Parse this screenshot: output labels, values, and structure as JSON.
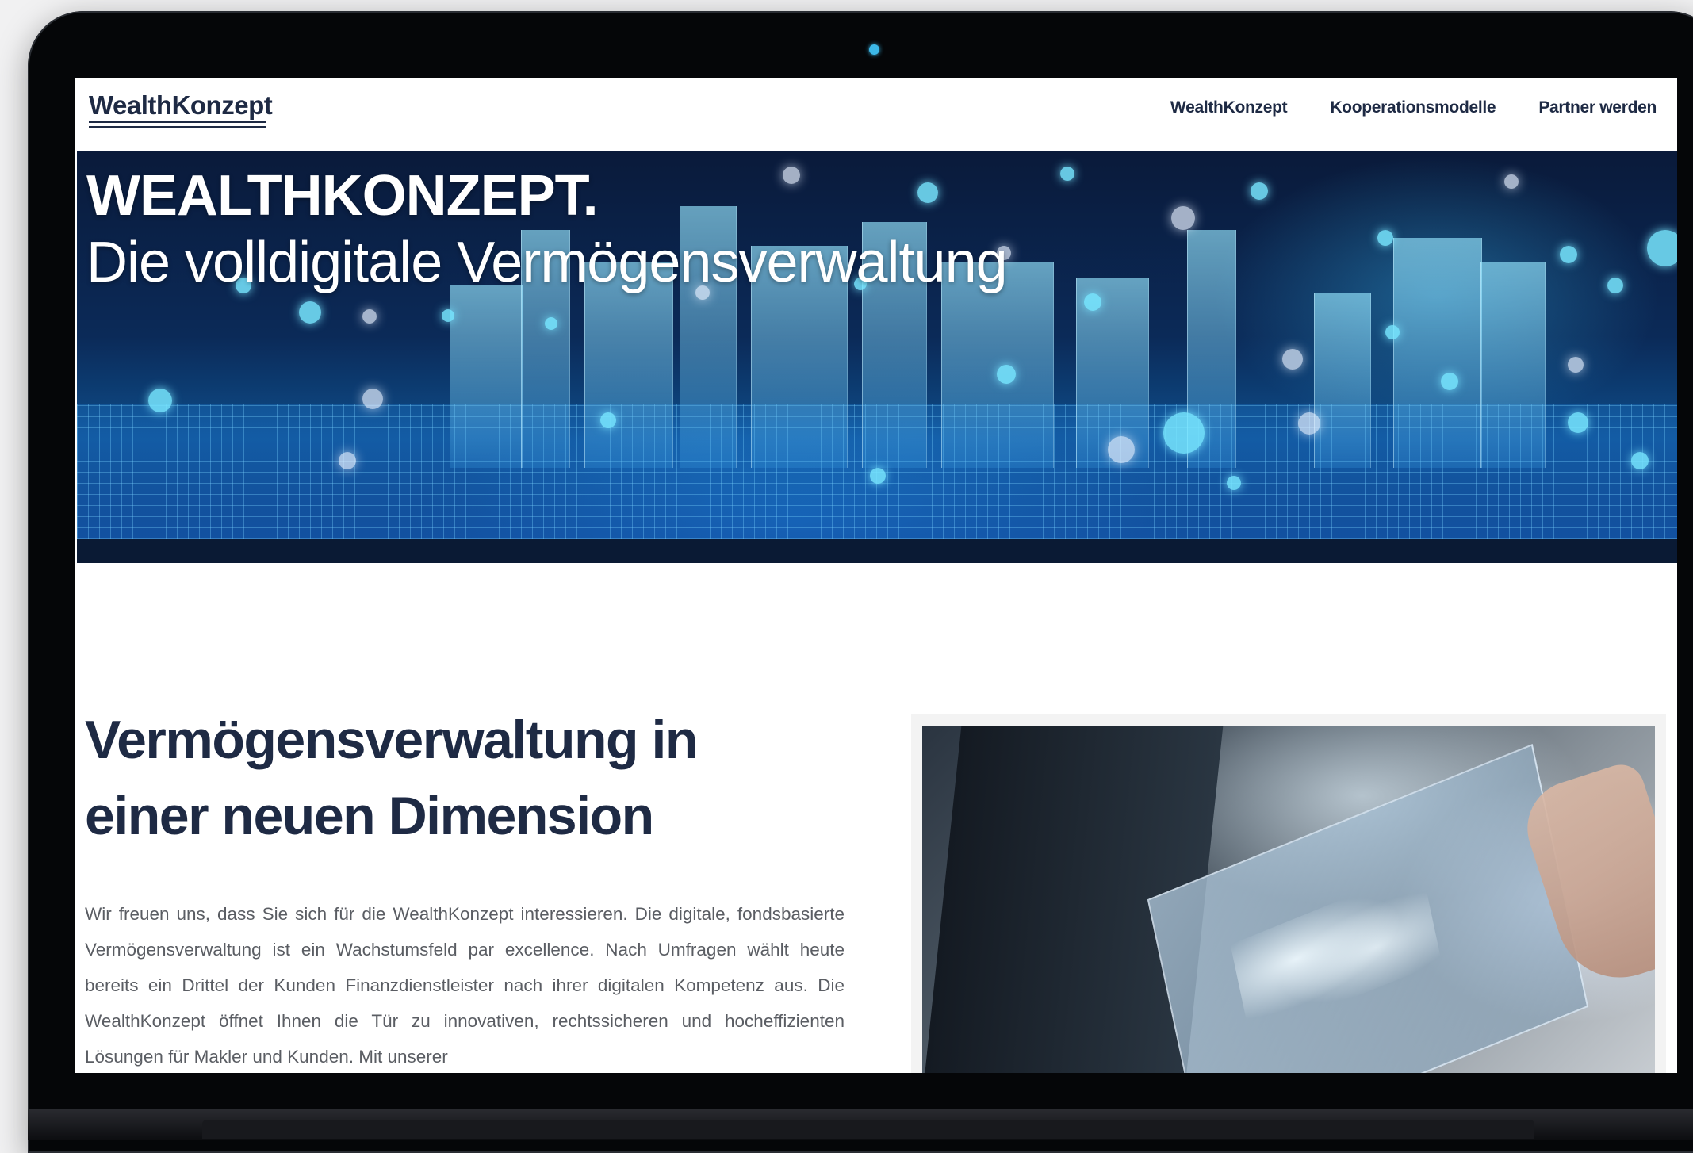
{
  "header": {
    "logo_text": "WealthKonzept",
    "nav": [
      {
        "label": "WealthKonzept"
      },
      {
        "label": "Kooperationsmodelle"
      },
      {
        "label": "Partner werden"
      }
    ]
  },
  "hero": {
    "title": "WEALTHKONZEPT.",
    "subtitle": "Die volldigitale Vermögensverwaltung"
  },
  "main": {
    "heading_line1": "Vermögensverwaltung in",
    "heading_line2": "einer neuen Dimension",
    "intro": "Wir freuen uns, dass Sie sich für die WealthKonzept interessieren. Die digitale, fondsbasierte Vermögensverwaltung ist ein Wachstumsfeld par excellence. Nach Umfragen wählt heute bereits ein Drittel der Kunden Finanzdienstleister nach ihrer digitalen Kompetenz aus. Die WealthKonzept öffnet Ihnen die Tür zu innovativen, rechtssicheren und hocheffizienten Lösungen für Makler und Kunden. Mit unserer"
  },
  "colors": {
    "brand_navy": "#1e2a44",
    "hero_blue": "#0b2a58",
    "body_text": "#5a5d63",
    "device_frame": "#050608",
    "background": "#f1f1f2"
  }
}
